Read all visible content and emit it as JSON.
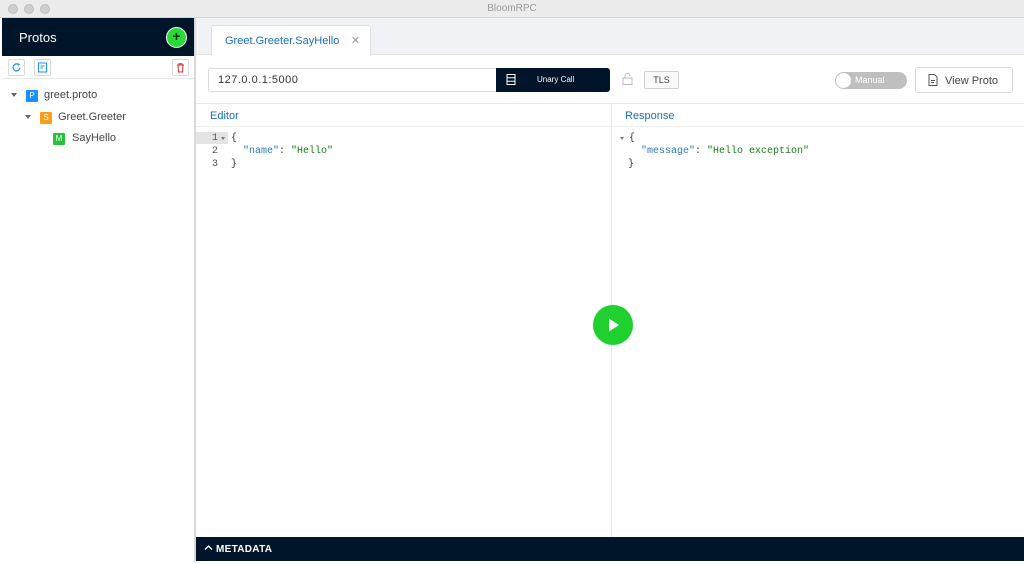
{
  "window": {
    "title": "BloomRPC"
  },
  "sidebar": {
    "title": "Protos",
    "add_icon": "plus-circle-icon",
    "tools": [
      "reload-icon",
      "import-icon",
      "delete-icon"
    ],
    "tree": [
      {
        "badge": "P",
        "label": "greet.proto",
        "badge_color": "#1890ff",
        "level": 0
      },
      {
        "badge": "S",
        "label": "Greet.Greeter",
        "badge_color": "#fa9d1a",
        "level": 1
      },
      {
        "badge": "M",
        "label": "SayHello",
        "badge_color": "#28c23a",
        "level": 2
      }
    ]
  },
  "tabs": [
    {
      "label": "Greet.Greeter.SayHello",
      "close_icon": "close-icon"
    }
  ],
  "toolbar": {
    "url_value": "127.0.0.1:5000",
    "call_label": "Unary Call",
    "tls_label": "TLS",
    "manual_label": "Manual",
    "view_proto_label": "View Proto"
  },
  "editor": {
    "title": "Editor",
    "line_numbers": [
      "1",
      "2",
      "3"
    ],
    "lines": {
      "open": "{",
      "key": "\"name\"",
      "sep": ": ",
      "value": "\"Hello\"",
      "close": "}"
    }
  },
  "response": {
    "title": "Response",
    "lines": {
      "open": "{",
      "key": "\"message\"",
      "sep": ": ",
      "value": "\"Hello exception\"",
      "close": "}"
    }
  },
  "metadata": {
    "label": "METADATA"
  },
  "colors": {
    "dark": "#001529",
    "accent": "#1a6fb7",
    "green": "#20d030"
  }
}
